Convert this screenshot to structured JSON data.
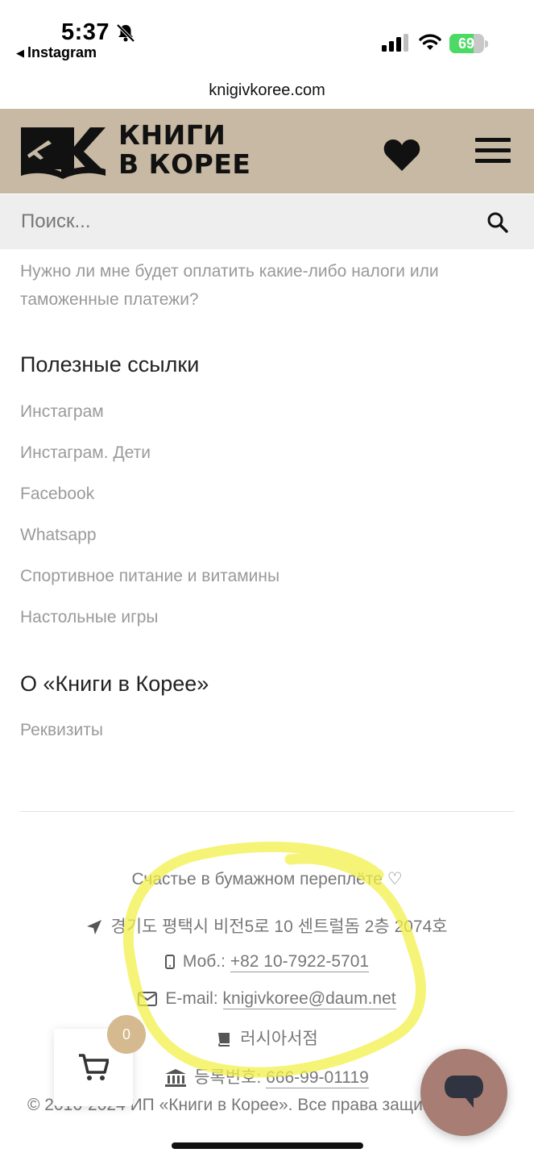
{
  "status_bar": {
    "time": "5:37",
    "back_app": "Instagram",
    "battery_percent": "69",
    "battery_level": 0.69,
    "icons": [
      "bell-off-icon",
      "signal-icon",
      "wifi-icon",
      "battery-icon"
    ]
  },
  "browser": {
    "url": "knigivkoree.com"
  },
  "header": {
    "logo_line1": "КНИГИ",
    "logo_line2": "В КОРЕЕ",
    "brand_color": "#c7b9a3",
    "icons": [
      "heart-icon",
      "menu-icon"
    ]
  },
  "search": {
    "placeholder": "Поиск..."
  },
  "faq_link": "Нужно ли мне будет оплатить какие-либо налоги или таможенные платежи?",
  "useful_links": {
    "title": "Полезные ссылки",
    "items": [
      "Инстаграм",
      "Инстаграм. Дети",
      "Facebook",
      "Whatsapp",
      "Спортивное питание и витамины",
      "Настольные игры"
    ]
  },
  "about": {
    "title": "О «Книги в Корее»",
    "items": [
      "Реквизиты"
    ]
  },
  "footer": {
    "tagline": "Счастье в бумажном переплёте ♡",
    "address": "경기도 평택시 비전5로 10 센트럴돔 2층 2074호",
    "mobile_label": "Моб.:",
    "mobile": "+82 10-7922-5701",
    "email_label": "E-mail:",
    "email": "knigivkoree@daum.net",
    "store_name": "러시아서점",
    "reg_label": "등록번호:",
    "reg_number": "666-99-01119",
    "copyright": "© 2016-2024 ИП «Книги в Корее». Все права защищены"
  },
  "cart": {
    "count": "0",
    "badge_color": "#d5b98f"
  },
  "chat": {
    "button_color": "#a87d73"
  },
  "annotation": {
    "color": "#f2f04a"
  }
}
